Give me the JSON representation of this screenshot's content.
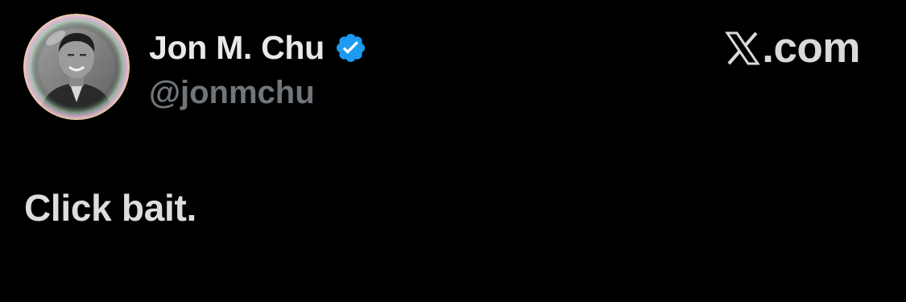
{
  "author": {
    "display_name": "Jon M. Chu",
    "handle": "@jonmchu",
    "verified": true,
    "verified_color": "#1d9bf0"
  },
  "brand": {
    "icon": "x-logo-icon",
    "label": ".com"
  },
  "tweet": {
    "text": "Click bait."
  },
  "colors": {
    "background": "#000000",
    "name": "#e7e9ea",
    "handle": "#71767b",
    "body_text": "#dddddd"
  }
}
